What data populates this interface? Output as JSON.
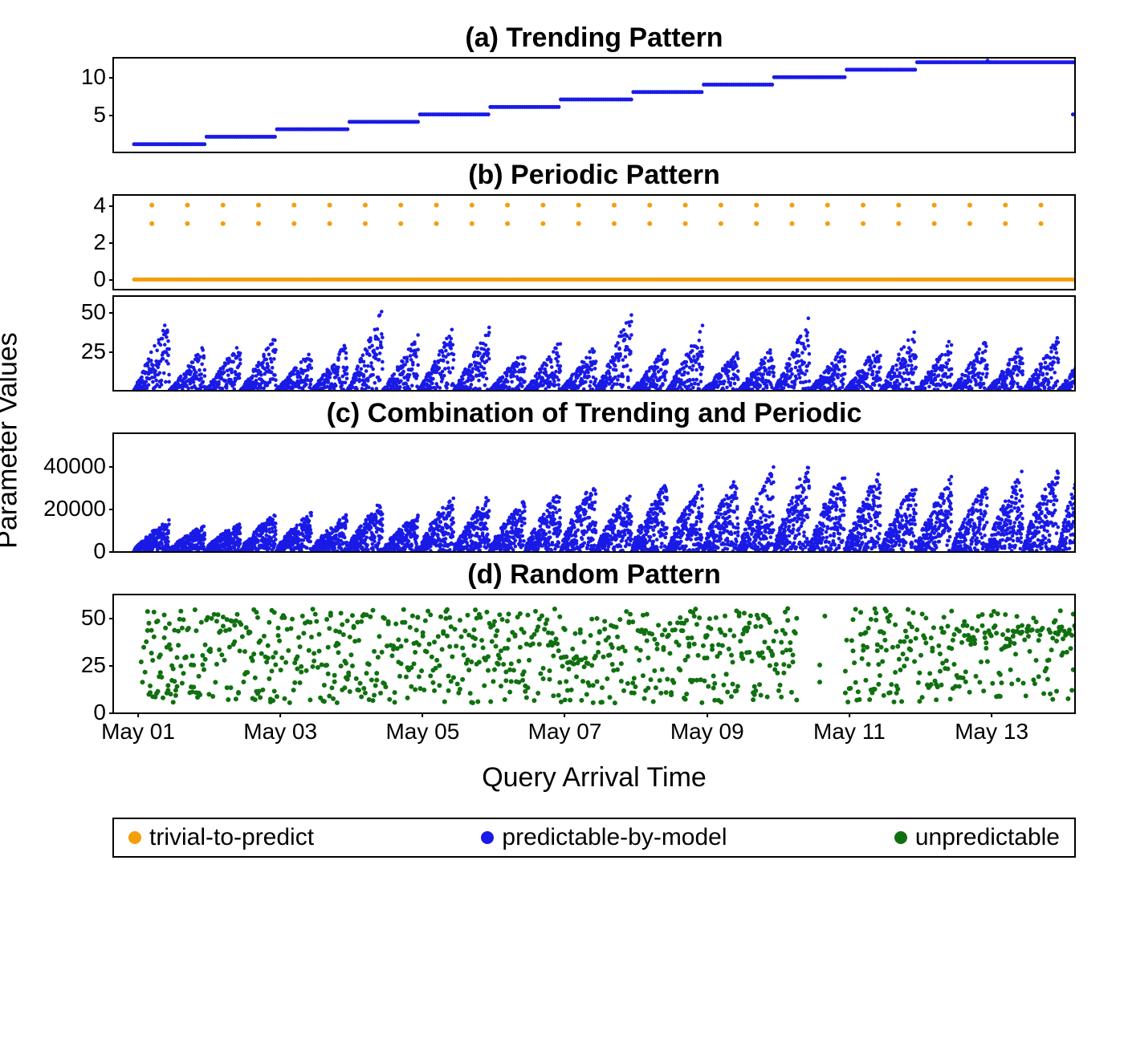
{
  "chart_data": [
    {
      "id": "a",
      "type": "scatter",
      "title": "(a) Trending Pattern",
      "series": "predictable-by-model",
      "color": "#1a1ae6",
      "ylim": [
        0,
        12.5
      ],
      "yticks": [
        5,
        10
      ],
      "note": "step-increasing integer parameter values 1..12 over May 01–May 14, one step per ~day"
    },
    {
      "id": "b1",
      "type": "scatter",
      "title": "(b) Periodic Pattern",
      "series": "trivial-to-predict",
      "color": "#f59e0b",
      "ylim": [
        -0.5,
        4.5
      ],
      "yticks": [
        0,
        2,
        4
      ],
      "note": "baseline at 0 continuously; periodic points at y=3 and y=4 twice per day"
    },
    {
      "id": "b2",
      "type": "scatter",
      "title": "",
      "series": "predictable-by-model",
      "color": "#1a1ae6",
      "ylim": [
        0,
        60
      ],
      "yticks": [
        25,
        50
      ],
      "note": "sawtooth bursts, ~2 per day, peaks 25–55"
    },
    {
      "id": "c",
      "type": "scatter",
      "title": "(c) Combination of Trending and Periodic",
      "series": "predictable-by-model",
      "color": "#1a1ae6",
      "ylim": [
        0,
        55000
      ],
      "yticks": [
        0,
        20000,
        40000
      ],
      "note": "dense triangular bursts ~2/day, envelope trending up from ~15000 to ~50000"
    },
    {
      "id": "d",
      "type": "scatter",
      "title": "(d) Random Pattern",
      "series": "unpredictable",
      "color": "#107010",
      "ylim": [
        0,
        62
      ],
      "yticks": [
        0,
        25,
        50
      ],
      "note": "noisy values between 0–58 across the full range, no clear period or trend"
    }
  ],
  "shared": {
    "xlabel": "Query Arrival Time",
    "ylabel": "Parameter Values",
    "xdomain": [
      "2024-05-01",
      "2024-05-14"
    ],
    "xticks": [
      "May 01",
      "May 03",
      "May 05",
      "May 07",
      "May 09",
      "May 11",
      "May 13"
    ]
  },
  "legend": [
    {
      "label": "trivial-to-predict",
      "color": "#f59e0b"
    },
    {
      "label": "predictable-by-model",
      "color": "#1a1ae6"
    },
    {
      "label": "unpredictable",
      "color": "#107010"
    }
  ]
}
